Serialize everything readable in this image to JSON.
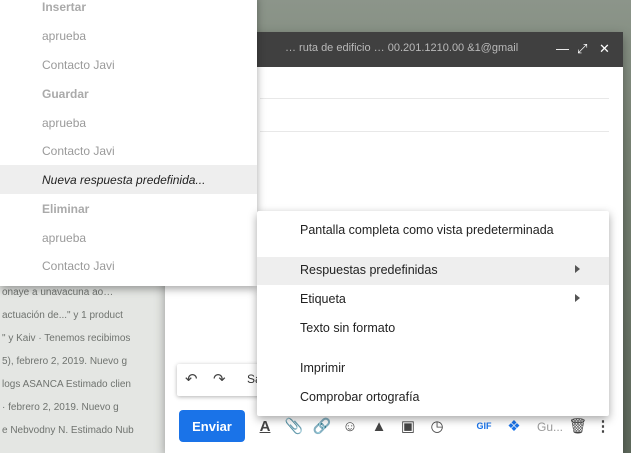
{
  "background_lines": [
    "onaye a unavacuna ao…",
    "actuación de...\" y 1 product",
    "\" y Kaiv · Tenemos recibimos",
    "5), febrero 2, 2019. Nuevo g",
    "logs ASANCA Estimado clien",
    "· febrero 2, 2019. Nuevo g",
    "e Nebvodny N. Estimado Nub"
  ],
  "compose": {
    "title": "… ruta de edificio … 00.201.1210.00 &1@gmail",
    "header_icons": [
      "minimize-icon",
      "expand-icon",
      "close-icon"
    ]
  },
  "left_menu": {
    "insert_header": "Insertar",
    "insert_items": [
      "aprueba",
      "Contacto Javi"
    ],
    "save_header": "Guardar",
    "save_items": [
      "aprueba",
      "Contacto Javi"
    ],
    "new_response": "Nueva respuesta predefinida...",
    "delete_header": "Eliminar",
    "delete_items": [
      "aprueba",
      "Contacto Javi"
    ]
  },
  "context_menu": {
    "items": [
      {
        "label": "Pantalla completa como vista predeterminada"
      },
      {
        "label": "Respuestas predefinidas",
        "submenu": true,
        "highlighted": true
      },
      {
        "label": "Etiqueta",
        "submenu": true
      },
      {
        "label": "Texto sin formato"
      },
      {
        "label": "Imprimir"
      },
      {
        "label": "Comprobar ortografía"
      }
    ]
  },
  "toolbar": {
    "send_label": "Enviar",
    "gif_label": "GIF",
    "truncated_label": "Gu...",
    "format_label": "Sa"
  },
  "colors": {
    "send_button": "#1a73e8",
    "header_bar": "#404040",
    "highlight": "#eeeeee"
  }
}
